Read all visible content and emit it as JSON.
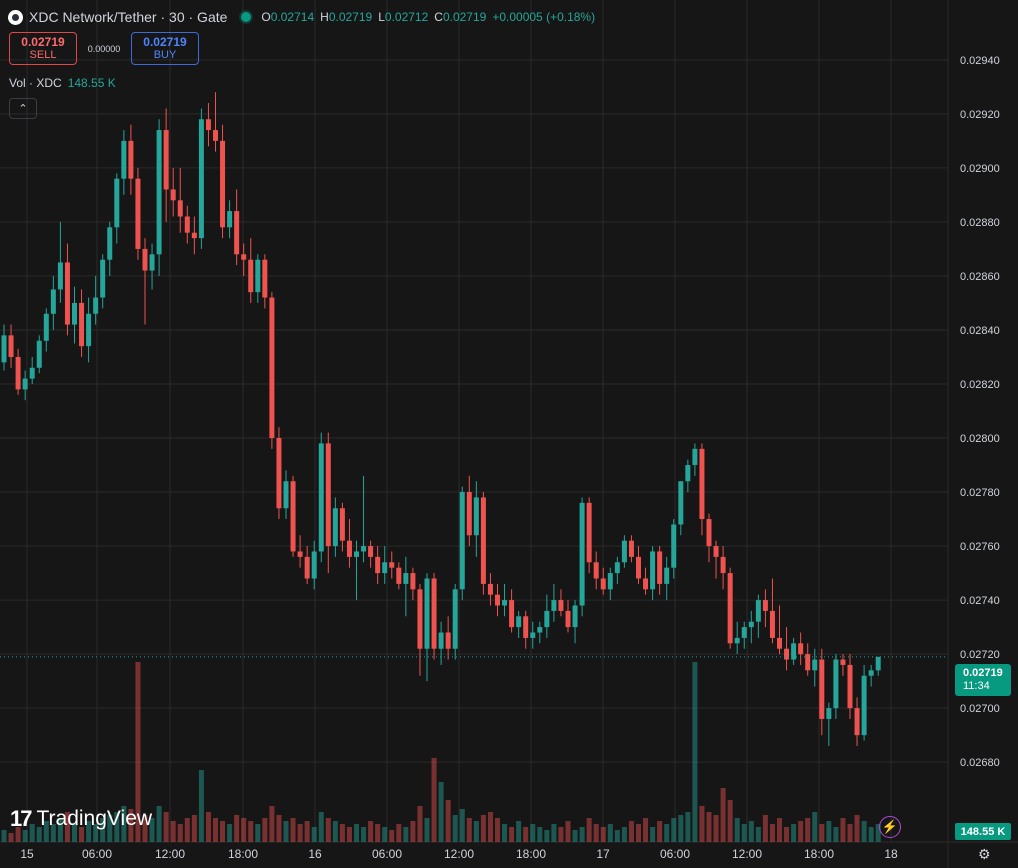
{
  "header": {
    "title": "XDC Network/Tether · 30 · Gate",
    "ohlc": [
      {
        "k": "O",
        "v": "0.02714"
      },
      {
        "k": "H",
        "v": "0.02719"
      },
      {
        "k": "L",
        "v": "0.02712"
      },
      {
        "k": "C",
        "v": "0.02719"
      }
    ],
    "change": "+0.00005 (+0.18%)"
  },
  "trade": {
    "sell_price": "0.02719",
    "sell_label": "SELL",
    "spread": "0.00000",
    "buy_price": "0.02719",
    "buy_label": "BUY"
  },
  "volume_legend": {
    "label": "Vol · XDC",
    "value": "148.55 K"
  },
  "price_tag": {
    "price": "0.02719",
    "countdown": "11:34"
  },
  "volume_tag": "148.55 K",
  "brand": "TradingView",
  "colors": {
    "up": "#26a69a",
    "down": "#ef5350",
    "background": "#161616",
    "grid": "#2a2a2a"
  },
  "icons": {
    "collapse": "chevron-up-icon",
    "lightning": "lightning-icon",
    "settings": "gear-icon"
  },
  "chart_data": {
    "type": "candlestick",
    "title": "XDC Network/Tether · 30 · Gate",
    "interval": "30",
    "ylim": [
      0.02666,
      0.02954
    ],
    "y_ticks": [
      "0.02940",
      "0.02920",
      "0.02900",
      "0.02880",
      "0.02860",
      "0.02840",
      "0.02820",
      "0.02800",
      "0.02780",
      "0.02760",
      "0.02740",
      "0.02720",
      "0.02700",
      "0.02680"
    ],
    "x_tick_labels": [
      "15",
      "06:00",
      "12:00",
      "18:00",
      "16",
      "06:00",
      "12:00",
      "18:00",
      "17",
      "06:00",
      "12:00",
      "18:00",
      "18"
    ],
    "grid": true,
    "series": [
      {
        "name": "XDC",
        "ohlc": [
          [
            0.02828,
            0.02842,
            0.02825,
            0.02838
          ],
          [
            0.02838,
            0.02842,
            0.02826,
            0.0283
          ],
          [
            0.0283,
            0.02833,
            0.02816,
            0.02818
          ],
          [
            0.02818,
            0.02825,
            0.02814,
            0.02822
          ],
          [
            0.02822,
            0.0283,
            0.0282,
            0.02826
          ],
          [
            0.02826,
            0.02838,
            0.02824,
            0.02836
          ],
          [
            0.02836,
            0.02848,
            0.02832,
            0.02846
          ],
          [
            0.02846,
            0.0286,
            0.0284,
            0.02855
          ],
          [
            0.02855,
            0.0288,
            0.0285,
            0.02865
          ],
          [
            0.02865,
            0.02872,
            0.02838,
            0.02842
          ],
          [
            0.02842,
            0.02856,
            0.02835,
            0.0285
          ],
          [
            0.0285,
            0.02855,
            0.0283,
            0.02834
          ],
          [
            0.02834,
            0.02852,
            0.02828,
            0.02846
          ],
          [
            0.02846,
            0.0286,
            0.02842,
            0.02852
          ],
          [
            0.02852,
            0.02868,
            0.02848,
            0.02866
          ],
          [
            0.02866,
            0.0288,
            0.0286,
            0.02878
          ],
          [
            0.02878,
            0.02898,
            0.02872,
            0.02896
          ],
          [
            0.02896,
            0.02914,
            0.0289,
            0.0291
          ],
          [
            0.0291,
            0.02916,
            0.0289,
            0.02896
          ],
          [
            0.02896,
            0.029,
            0.02866,
            0.0287
          ],
          [
            0.0287,
            0.02874,
            0.02842,
            0.02862
          ],
          [
            0.02862,
            0.02872,
            0.02855,
            0.02868
          ],
          [
            0.02868,
            0.02918,
            0.0286,
            0.02914
          ],
          [
            0.02914,
            0.02922,
            0.0288,
            0.02892
          ],
          [
            0.02892,
            0.029,
            0.02882,
            0.02888
          ],
          [
            0.02888,
            0.029,
            0.02876,
            0.02882
          ],
          [
            0.02882,
            0.02886,
            0.02872,
            0.02876
          ],
          [
            0.02876,
            0.02882,
            0.02868,
            0.02874
          ],
          [
            0.02874,
            0.02922,
            0.0287,
            0.02918
          ],
          [
            0.02918,
            0.02924,
            0.02908,
            0.02914
          ],
          [
            0.02914,
            0.02928,
            0.02906,
            0.0291
          ],
          [
            0.0291,
            0.02916,
            0.02874,
            0.02878
          ],
          [
            0.02878,
            0.02888,
            0.02874,
            0.02884
          ],
          [
            0.02884,
            0.02892,
            0.02864,
            0.02868
          ],
          [
            0.02868,
            0.02872,
            0.0286,
            0.02866
          ],
          [
            0.02866,
            0.02874,
            0.0285,
            0.02854
          ],
          [
            0.02854,
            0.02868,
            0.0285,
            0.02866
          ],
          [
            0.02866,
            0.02868,
            0.02848,
            0.02852
          ],
          [
            0.02852,
            0.02854,
            0.02796,
            0.028
          ],
          [
            0.028,
            0.02804,
            0.0277,
            0.02774
          ],
          [
            0.02774,
            0.02788,
            0.0277,
            0.02784
          ],
          [
            0.02784,
            0.02786,
            0.02756,
            0.02758
          ],
          [
            0.02758,
            0.02764,
            0.02752,
            0.02756
          ],
          [
            0.02756,
            0.0276,
            0.02746,
            0.02748
          ],
          [
            0.02748,
            0.02762,
            0.02744,
            0.02758
          ],
          [
            0.02758,
            0.02802,
            0.02754,
            0.02798
          ],
          [
            0.02798,
            0.02802,
            0.0275,
            0.0276
          ],
          [
            0.0276,
            0.02778,
            0.02756,
            0.02774
          ],
          [
            0.02774,
            0.02776,
            0.02758,
            0.02762
          ],
          [
            0.02762,
            0.0277,
            0.02752,
            0.02756
          ],
          [
            0.02756,
            0.02762,
            0.0274,
            0.02758
          ],
          [
            0.02758,
            0.02786,
            0.02754,
            0.0276
          ],
          [
            0.0276,
            0.02762,
            0.02752,
            0.02756
          ],
          [
            0.02756,
            0.0276,
            0.02746,
            0.0275
          ],
          [
            0.0275,
            0.0276,
            0.02746,
            0.02754
          ],
          [
            0.02754,
            0.02758,
            0.02748,
            0.02752
          ],
          [
            0.02752,
            0.02754,
            0.02744,
            0.02746
          ],
          [
            0.02746,
            0.02756,
            0.02734,
            0.0275
          ],
          [
            0.0275,
            0.02752,
            0.0274,
            0.02744
          ],
          [
            0.02744,
            0.02746,
            0.02712,
            0.02722
          ],
          [
            0.02722,
            0.0275,
            0.0271,
            0.02748
          ],
          [
            0.02748,
            0.0275,
            0.02718,
            0.02722
          ],
          [
            0.02722,
            0.02732,
            0.02716,
            0.02728
          ],
          [
            0.02728,
            0.02734,
            0.02718,
            0.02722
          ],
          [
            0.02722,
            0.02746,
            0.02718,
            0.02744
          ],
          [
            0.02744,
            0.02782,
            0.0274,
            0.0278
          ],
          [
            0.0278,
            0.02786,
            0.0276,
            0.02764
          ],
          [
            0.02764,
            0.02784,
            0.02756,
            0.02778
          ],
          [
            0.02778,
            0.0278,
            0.02742,
            0.02746
          ],
          [
            0.02746,
            0.0275,
            0.02738,
            0.02742
          ],
          [
            0.02742,
            0.02746,
            0.02734,
            0.02738
          ],
          [
            0.02738,
            0.02746,
            0.02734,
            0.0274
          ],
          [
            0.0274,
            0.02744,
            0.02728,
            0.0273
          ],
          [
            0.0273,
            0.02736,
            0.02726,
            0.02734
          ],
          [
            0.02734,
            0.02736,
            0.02722,
            0.02726
          ],
          [
            0.02726,
            0.02732,
            0.02722,
            0.02728
          ],
          [
            0.02728,
            0.02732,
            0.02724,
            0.0273
          ],
          [
            0.0273,
            0.02742,
            0.02726,
            0.02736
          ],
          [
            0.02736,
            0.02746,
            0.02732,
            0.0274
          ],
          [
            0.0274,
            0.02744,
            0.02734,
            0.02736
          ],
          [
            0.02736,
            0.0274,
            0.02728,
            0.0273
          ],
          [
            0.0273,
            0.0274,
            0.02724,
            0.02738
          ],
          [
            0.02738,
            0.02778,
            0.02734,
            0.02776
          ],
          [
            0.02776,
            0.02778,
            0.0275,
            0.02754
          ],
          [
            0.02754,
            0.02758,
            0.02744,
            0.02748
          ],
          [
            0.02748,
            0.02752,
            0.02742,
            0.02744
          ],
          [
            0.02744,
            0.02752,
            0.0274,
            0.0275
          ],
          [
            0.0275,
            0.02756,
            0.02746,
            0.02754
          ],
          [
            0.02754,
            0.02764,
            0.02752,
            0.02762
          ],
          [
            0.02762,
            0.02764,
            0.02754,
            0.02756
          ],
          [
            0.02756,
            0.0276,
            0.02746,
            0.02748
          ],
          [
            0.02748,
            0.02752,
            0.02742,
            0.02744
          ],
          [
            0.02744,
            0.0276,
            0.0274,
            0.02758
          ],
          [
            0.02758,
            0.0276,
            0.02742,
            0.02746
          ],
          [
            0.02746,
            0.02756,
            0.0274,
            0.02752
          ],
          [
            0.02752,
            0.0277,
            0.02748,
            0.02768
          ],
          [
            0.02768,
            0.02784,
            0.02764,
            0.02784
          ],
          [
            0.02784,
            0.02792,
            0.0278,
            0.0279
          ],
          [
            0.0279,
            0.02798,
            0.02786,
            0.02796
          ],
          [
            0.02796,
            0.02798,
            0.02764,
            0.0277
          ],
          [
            0.0277,
            0.02772,
            0.02754,
            0.0276
          ],
          [
            0.0276,
            0.02762,
            0.02748,
            0.02756
          ],
          [
            0.02756,
            0.0276,
            0.02744,
            0.0275
          ],
          [
            0.0275,
            0.02752,
            0.02722,
            0.02724
          ],
          [
            0.02724,
            0.02732,
            0.0272,
            0.02726
          ],
          [
            0.02726,
            0.02732,
            0.02722,
            0.0273
          ],
          [
            0.0273,
            0.02736,
            0.02724,
            0.02732
          ],
          [
            0.02732,
            0.02742,
            0.02726,
            0.0274
          ],
          [
            0.0274,
            0.02744,
            0.0273,
            0.02736
          ],
          [
            0.02736,
            0.02748,
            0.02724,
            0.02726
          ],
          [
            0.02726,
            0.02738,
            0.0272,
            0.02722
          ],
          [
            0.02722,
            0.0273,
            0.02714,
            0.02718
          ],
          [
            0.02718,
            0.02726,
            0.02716,
            0.02724
          ],
          [
            0.02724,
            0.02728,
            0.02716,
            0.0272
          ],
          [
            0.0272,
            0.02724,
            0.02712,
            0.02714
          ],
          [
            0.02714,
            0.02722,
            0.02708,
            0.02718
          ],
          [
            0.02718,
            0.02722,
            0.0269,
            0.02696
          ],
          [
            0.02696,
            0.02702,
            0.02686,
            0.027
          ],
          [
            0.027,
            0.0272,
            0.02696,
            0.02718
          ],
          [
            0.02718,
            0.0272,
            0.02712,
            0.02716
          ],
          [
            0.02716,
            0.0272,
            0.02696,
            0.027
          ],
          [
            0.027,
            0.02704,
            0.02686,
            0.0269
          ],
          [
            0.0269,
            0.02716,
            0.02688,
            0.02712
          ],
          [
            0.02712,
            0.02716,
            0.02708,
            0.02714
          ],
          [
            0.02714,
            0.02719,
            0.02712,
            0.02719
          ]
        ],
        "volume": [
          4,
          3,
          5,
          4,
          6,
          5,
          7,
          6,
          8,
          10,
          6,
          5,
          7,
          6,
          8,
          9,
          10,
          12,
          11,
          60,
          9,
          8,
          12,
          10,
          7,
          6,
          8,
          9,
          24,
          10,
          8,
          7,
          6,
          9,
          8,
          7,
          6,
          8,
          12,
          9,
          7,
          8,
          6,
          7,
          5,
          10,
          8,
          7,
          6,
          5,
          6,
          5,
          7,
          6,
          5,
          4,
          6,
          5,
          7,
          12,
          8,
          28,
          20,
          14,
          9,
          11,
          8,
          7,
          9,
          10,
          8,
          6,
          5,
          7,
          5,
          6,
          5,
          4,
          6,
          5,
          7,
          4,
          5,
          8,
          6,
          5,
          6,
          4,
          5,
          7,
          6,
          8,
          5,
          7,
          6,
          8,
          9,
          10,
          60,
          12,
          10,
          9,
          18,
          14,
          8,
          6,
          7,
          5,
          9,
          6,
          8,
          5,
          6,
          7,
          8,
          10,
          6,
          7,
          5,
          8,
          6,
          9,
          7,
          5,
          6
        ]
      }
    ],
    "last_price": 0.02719
  }
}
